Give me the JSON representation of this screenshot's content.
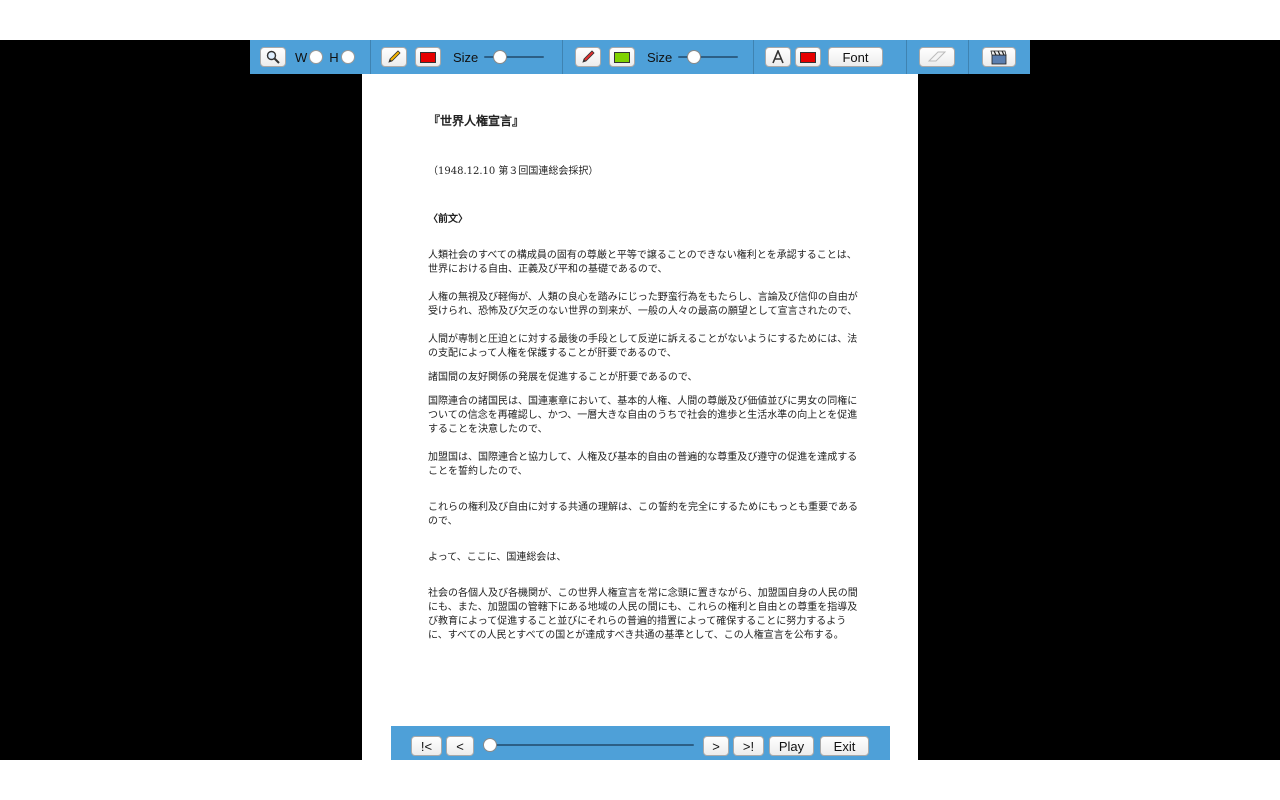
{
  "toolbar": {
    "zoom_icon": "magnifier-icon",
    "width_label": "W",
    "height_label": "H",
    "pen_icon": "pencil-icon",
    "pen_color": "#e60000",
    "pen_size_label": "Size",
    "marker_icon": "marker-icon",
    "marker_color": "#7fd200",
    "marker_size_label": "Size",
    "text_icon": "text-A-icon",
    "text_color": "#e60000",
    "font_label": "Font",
    "eraser_icon": "eraser-icon",
    "clapper_icon": "clapperboard-icon"
  },
  "document": {
    "title": "『世界人権宣言』",
    "adopted": "（1948.12.10 第３回国連総会採択）",
    "preface_heading": "〈前文〉",
    "paragraphs": [
      "人類社会のすべての構成員の固有の尊厳と平等で譲ることのできない権利とを承認することは、世界における自由、正義及び平和の基礎であるので、",
      "人権の無視及び軽侮が、人類の良心を踏みにじった野蛮行為をもたらし、言論及び信仰の自由が受けられ、恐怖及び欠乏のない世界の到来が、一般の人々の最高の願望として宣言されたので、",
      "人間が専制と圧迫とに対する最後の手段として反逆に訴えることがないようにするためには、法の支配によって人権を保護することが肝要であるので、",
      "諸国間の友好関係の発展を促進することが肝要であるので、",
      "国際連合の諸国民は、国連憲章において、基本的人権、人間の尊厳及び価値並びに男女の同権についての信念を再確認し、かつ、一層大きな自由のうちで社会的進歩と生活水準の向上とを促進することを決意したので、",
      "加盟国は、国際連合と協力して、人権及び基本的自由の普遍的な尊重及び遵守の促進を達成することを誓約したので、",
      "これらの権利及び自由に対する共通の理解は、この誓約を完全にするためにもっとも重要であるので、",
      "よって、ここに、国連総会は、",
      "社会の各個人及び各機関が、この世界人権宣言を常に念頭に置きながら、加盟国自身の人民の間にも、また、加盟国の管轄下にある地域の人民の間にも、これらの権利と自由との尊重を指導及び教育によって促進すること並びにそれらの普遍的措置によって確保することに努力するように、すべての人民とすべての国とが達成すべき共通の基準として、この人権宣言を公布する。"
    ]
  },
  "nav": {
    "first": "!<",
    "prev": "<",
    "next": ">",
    "last": ">!",
    "play": "Play",
    "exit": "Exit",
    "position_fraction": 0.0
  }
}
